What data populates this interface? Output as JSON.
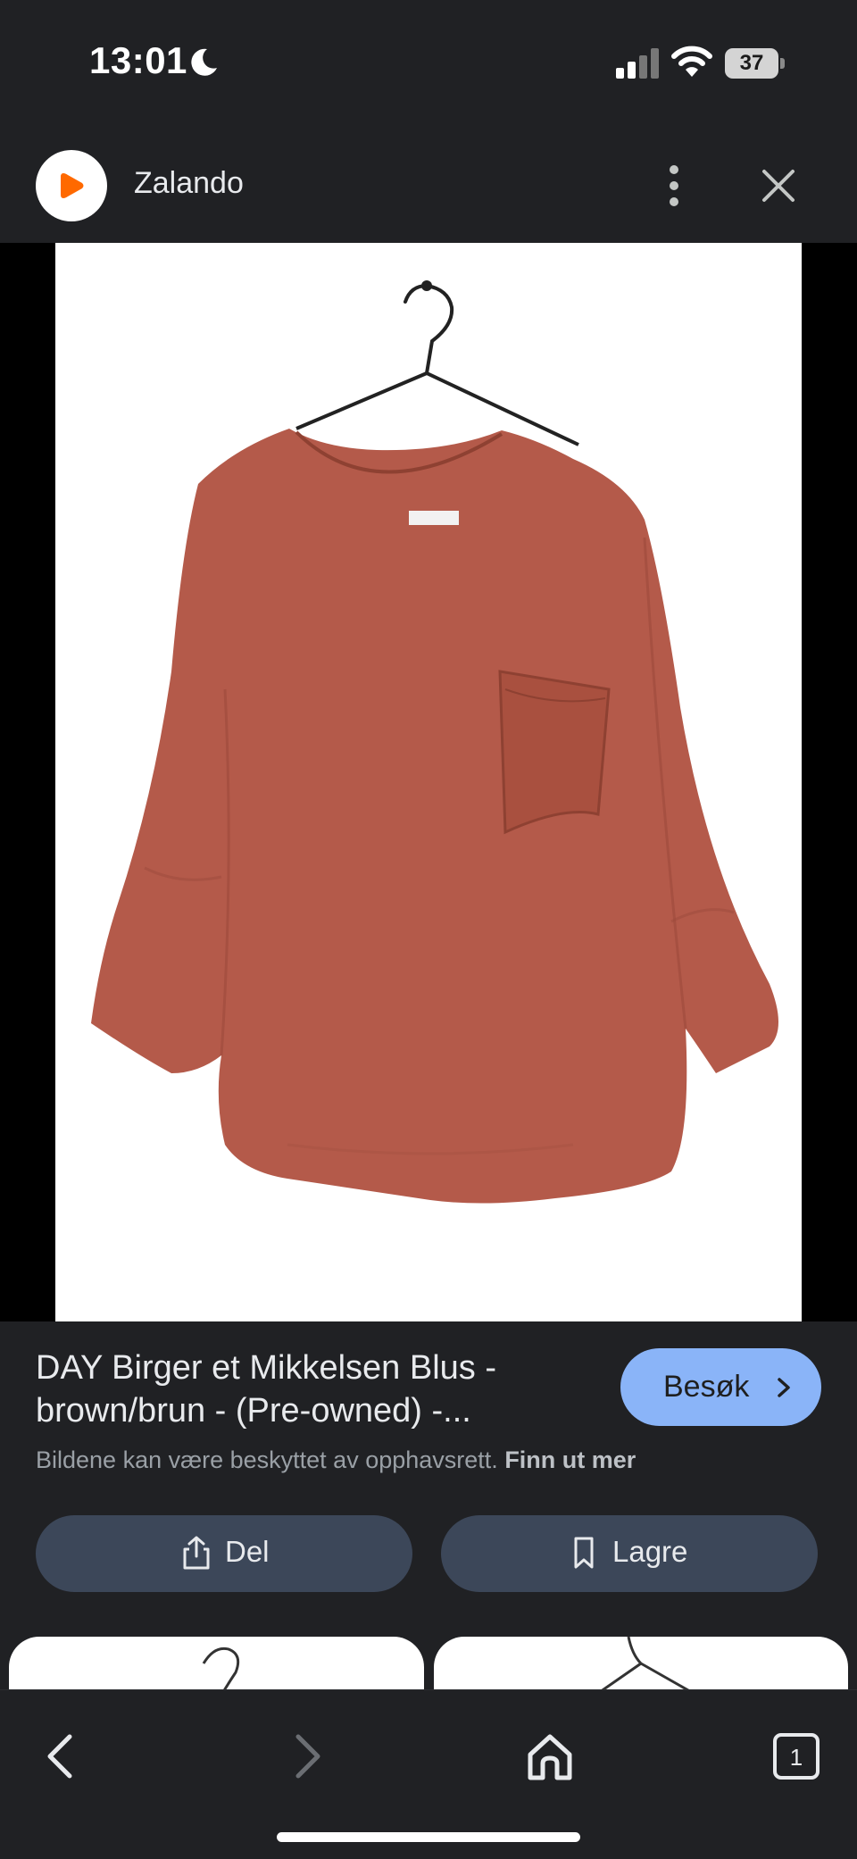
{
  "status_bar": {
    "time": "13:01",
    "battery": "37",
    "icons": [
      "moon-icon",
      "signal-icon",
      "wifi-icon",
      "battery-icon"
    ]
  },
  "header": {
    "site_name": "Zalando",
    "logo_icon": "zalando-play-logo",
    "brand_color": "#ff6900"
  },
  "result": {
    "title_line1": "DAY Birger et Mikkelsen Blus -",
    "title_line2": "brown/brun - (Pre-owned) -...",
    "visit_label": "Besøk",
    "copyright_text": "Bildene kan være beskyttet av opphavsrett.",
    "learn_more": "Finn ut mer"
  },
  "actions": {
    "share_label": "Del",
    "save_label": "Lagre"
  },
  "colors": {
    "background": "#202124",
    "accent": "#8ab4f8",
    "action_button": "#3c4759",
    "blouse": "#b45a4a"
  },
  "bottom_nav": {
    "tab_count": "1",
    "icons": [
      "back-icon",
      "forward-icon",
      "home-icon",
      "tabs-icon"
    ]
  }
}
